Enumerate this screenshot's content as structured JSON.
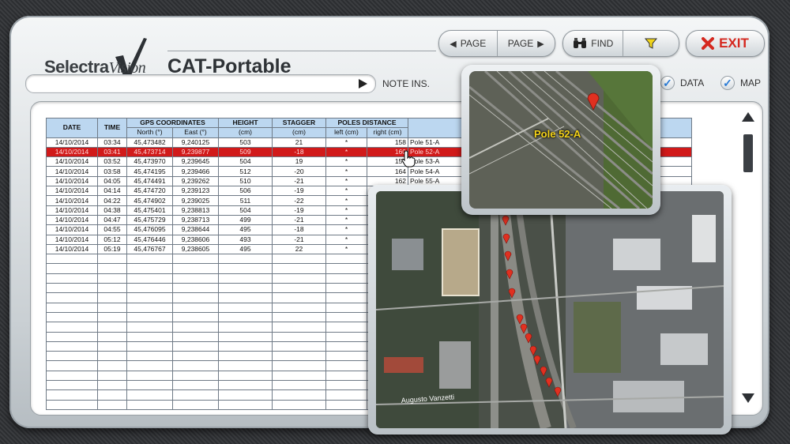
{
  "app": {
    "brand_main": "Selectra",
    "brand_italic": "Vision",
    "title": "CAT-Portable"
  },
  "toolbar": {
    "prev_page": "PAGE",
    "next_page": "PAGE",
    "find": "FIND",
    "exit": "EXIT"
  },
  "note": {
    "label": "NOTE INS.",
    "value": ""
  },
  "toggles": {
    "data": {
      "label": "DATA",
      "checked": true
    },
    "map": {
      "label": "MAP",
      "checked": true
    }
  },
  "table": {
    "headers": {
      "date": "DATE",
      "time": "TIME",
      "gps": "GPS COORDINATES",
      "north": "North (°)",
      "east": "East (°)",
      "height": "HEIGHT",
      "height_unit": "(cm)",
      "stagger": "STAGGER",
      "stagger_unit": "(cm)",
      "poles": "POLES DISTANCE",
      "left": "left (cm)",
      "right": "right (cm)"
    },
    "selected_index": 1,
    "rows": [
      {
        "date": "14/10/2014",
        "time": "03:34",
        "north": "45,473482",
        "east": "9,240125",
        "height": "503",
        "stagger": "21",
        "left": "*",
        "right": "158",
        "pole": "Pole 51-A"
      },
      {
        "date": "14/10/2014",
        "time": "03:41",
        "north": "45,473714",
        "east": "9,239877",
        "height": "509",
        "stagger": "-18",
        "left": "*",
        "right": "160",
        "pole": "Pole 52-A"
      },
      {
        "date": "14/10/2014",
        "time": "03:52",
        "north": "45,473970",
        "east": "9,239645",
        "height": "504",
        "stagger": "19",
        "left": "*",
        "right": "156",
        "pole": "Pole 53-A"
      },
      {
        "date": "14/10/2014",
        "time": "03:58",
        "north": "45,474195",
        "east": "9,239466",
        "height": "512",
        "stagger": "-20",
        "left": "*",
        "right": "164",
        "pole": "Pole 54-A"
      },
      {
        "date": "14/10/2014",
        "time": "04:05",
        "north": "45,474491",
        "east": "9,239262",
        "height": "510",
        "stagger": "-21",
        "left": "*",
        "right": "162",
        "pole": "Pole 55-A"
      },
      {
        "date": "14/10/2014",
        "time": "04:14",
        "north": "45,474720",
        "east": "9,239123",
        "height": "506",
        "stagger": "-19",
        "left": "*",
        "right": "",
        "pole": ""
      },
      {
        "date": "14/10/2014",
        "time": "04:22",
        "north": "45,474902",
        "east": "9,239025",
        "height": "511",
        "stagger": "-22",
        "left": "*",
        "right": "",
        "pole": ""
      },
      {
        "date": "14/10/2014",
        "time": "04:38",
        "north": "45,475401",
        "east": "9,238813",
        "height": "504",
        "stagger": "-19",
        "left": "*",
        "right": "",
        "pole": ""
      },
      {
        "date": "14/10/2014",
        "time": "04:47",
        "north": "45,475729",
        "east": "9,238713",
        "height": "499",
        "stagger": "-21",
        "left": "*",
        "right": "",
        "pole": ""
      },
      {
        "date": "14/10/2014",
        "time": "04:55",
        "north": "45,476095",
        "east": "9,238644",
        "height": "495",
        "stagger": "-18",
        "left": "*",
        "right": "",
        "pole": ""
      },
      {
        "date": "14/10/2014",
        "time": "05:12",
        "north": "45,476446",
        "east": "9,238606",
        "height": "493",
        "stagger": "-21",
        "left": "*",
        "right": "",
        "pole": ""
      },
      {
        "date": "14/10/2014",
        "time": "05:19",
        "north": "45,476767",
        "east": "9,238605",
        "height": "495",
        "stagger": "22",
        "left": "*",
        "right": "",
        "pole": ""
      }
    ],
    "empty_rows": 16
  },
  "map_zoom": {
    "pole_label": "Pole 52-A"
  },
  "map_overview": {
    "street_label": "Augusto Vanzetti"
  },
  "colors": {
    "selected_row": "#d11a1a",
    "header_bg": "#bcd7f0",
    "exit_red": "#d5281f",
    "marker_red": "#e03020",
    "pole_label": "#f5d318"
  }
}
